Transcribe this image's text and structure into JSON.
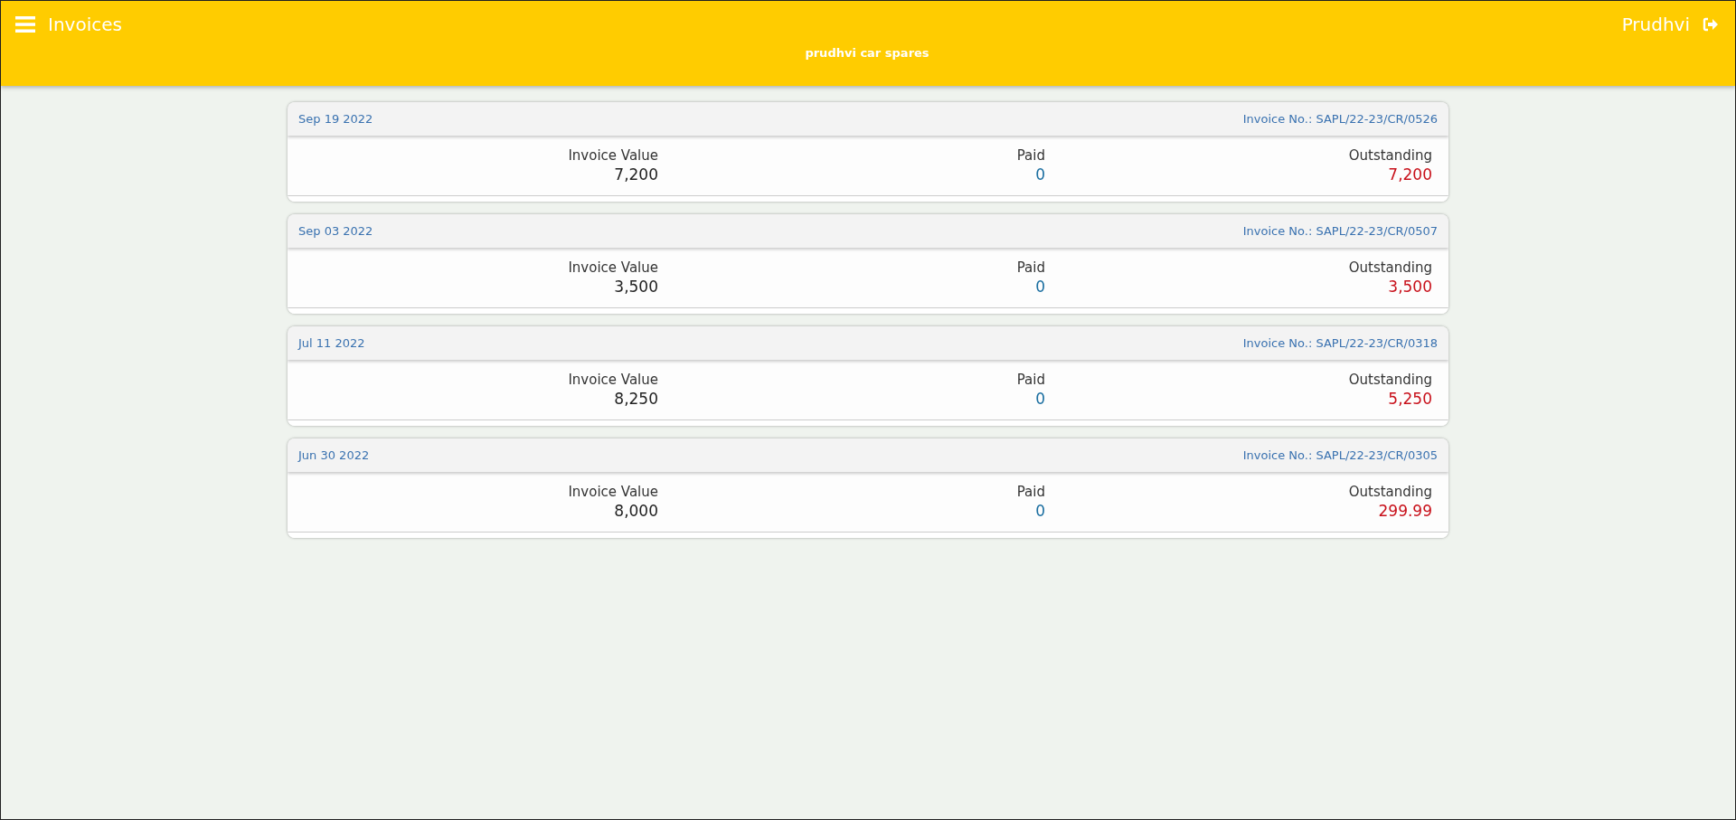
{
  "header": {
    "title": "Invoices",
    "subtitle": "prudhvi car spares",
    "user": "Prudhvi"
  },
  "invoices": [
    {
      "date": "Sep 19 2022",
      "number": "Invoice No.: SAPL/22-23/CR/0526",
      "fields": [
        {
          "label": "Invoice Value",
          "value": "7,200",
          "kind": "total"
        },
        {
          "label": "Paid",
          "value": "0",
          "kind": "paid"
        },
        {
          "label": "Outstanding",
          "value": "7,200",
          "kind": "due"
        }
      ]
    },
    {
      "date": "Sep 03 2022",
      "number": "Invoice No.: SAPL/22-23/CR/0507",
      "fields": [
        {
          "label": "Invoice Value",
          "value": "3,500",
          "kind": "total"
        },
        {
          "label": "Paid",
          "value": "0",
          "kind": "paid"
        },
        {
          "label": "Outstanding",
          "value": "3,500",
          "kind": "due"
        }
      ]
    },
    {
      "date": "Jul 11 2022",
      "number": "Invoice No.: SAPL/22-23/CR/0318",
      "fields": [
        {
          "label": "Invoice Value",
          "value": "8,250",
          "kind": "total"
        },
        {
          "label": "Paid",
          "value": "0",
          "kind": "paid"
        },
        {
          "label": "Outstanding",
          "value": "5,250",
          "kind": "due"
        }
      ]
    },
    {
      "date": "Jun 30 2022",
      "number": "Invoice No.: SAPL/22-23/CR/0305",
      "fields": [
        {
          "label": "Invoice Value",
          "value": "8,000",
          "kind": "total"
        },
        {
          "label": "Paid",
          "value": "0",
          "kind": "paid"
        },
        {
          "label": "Outstanding",
          "value": "299.99",
          "kind": "due"
        }
      ]
    }
  ]
}
